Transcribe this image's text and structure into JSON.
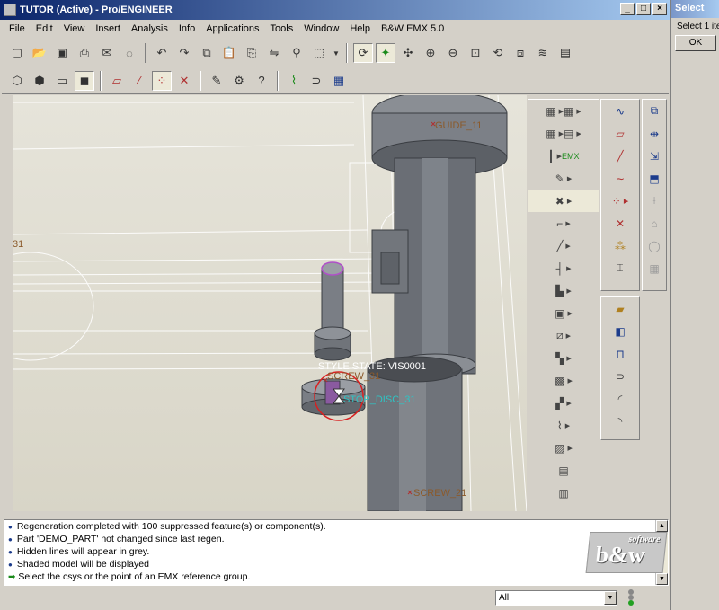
{
  "window": {
    "title": "TUTOR (Active) - Pro/ENGINEER",
    "minimize": "_",
    "maximize": "□",
    "close": "×"
  },
  "menu": [
    "File",
    "Edit",
    "View",
    "Insert",
    "Analysis",
    "Info",
    "Applications",
    "Tools",
    "Window",
    "Help",
    "B&W EMX 5.0"
  ],
  "toolbar1": [
    "new-icon",
    "open-icon",
    "save-icon",
    "print-icon",
    "email-icon",
    "erase-icon",
    "undo-icon",
    "redo-icon",
    "copy-icon",
    "paste-icon",
    "paste-special-icon",
    "mirror-icon",
    "find-icon",
    "select-box-icon",
    "repaint-icon",
    "spin-center-icon",
    "orient-icon",
    "zoom-in-icon",
    "zoom-out-icon",
    "refit-icon",
    "reorient-icon",
    "saved-views-icon",
    "layers-icon",
    "model-tree-icon"
  ],
  "toolbar2": [
    "wireframe-icon",
    "hidden-line-icon",
    "no-hidden-icon",
    "shading-icon",
    "datum-planes-icon",
    "datum-axes-icon",
    "datum-points-icon",
    "csys-icon",
    "sketch-icon",
    "parameters-icon",
    "whats-this-icon",
    "spline-icon",
    "routing-icon",
    "emx-icon"
  ],
  "viewport": {
    "labels": [
      {
        "text": "GUIDE_11",
        "color": "#8b5a2b"
      },
      {
        "text": "31",
        "color": "#8b5a2b"
      },
      {
        "text": "STYLE STATE: VIS0001",
        "color": "#ffffff"
      },
      {
        "text": "SCREW_31",
        "color": "#8b5a2b"
      },
      {
        "text": "STOP_DISC_31",
        "color": "#2ec4c4"
      },
      {
        "text": "SCREW_21",
        "color": "#8b5a2b"
      }
    ]
  },
  "status": {
    "messages": [
      {
        "bullet": "dot",
        "text": "Regeneration completed with 100 suppressed feature(s) or component(s)."
      },
      {
        "bullet": "dot",
        "text": "Part 'DEMO_PART' not changed since last regen."
      },
      {
        "bullet": "dot",
        "text": "Hidden lines will appear in grey."
      },
      {
        "bullet": "dot",
        "text": "Shaded model will be displayed"
      },
      {
        "bullet": "arrow",
        "text": "Select the csys or the point of an EMX reference group."
      }
    ]
  },
  "filter": {
    "value": "All"
  },
  "logo": {
    "top": "software",
    "main": "b&w"
  },
  "select_dialog": {
    "title": "Select",
    "text": "Select 1 ite",
    "ok": "OK"
  }
}
